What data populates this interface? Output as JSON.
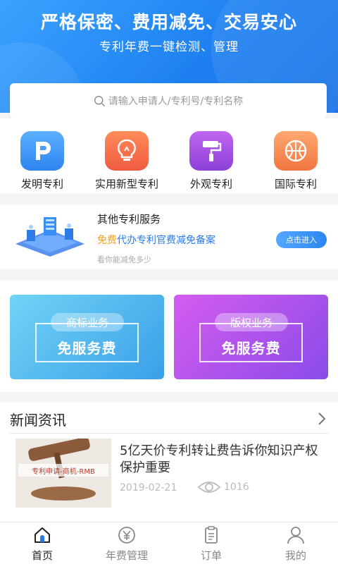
{
  "hero": {
    "title": "严格保密、费用减免、交易安心",
    "subtitle": "专利年费一键检测、管理"
  },
  "search": {
    "placeholder": "请输入申请人/专利号/专利名称",
    "icon": "search-icon"
  },
  "categories": [
    {
      "label": "发明专利",
      "icon": "p-letter-icon",
      "color": "#3b8ff0"
    },
    {
      "label": "实用新型专利",
      "icon": "lightbulb-icon",
      "color": "#f26a4a"
    },
    {
      "label": "外观专利",
      "icon": "paint-roller-icon",
      "color": "#a04de0"
    },
    {
      "label": "国际专利",
      "icon": "basketball-icon",
      "color": "#f2894a"
    }
  ],
  "service": {
    "title": "其他专利服务",
    "free": "免费",
    "desc": "代办专利官费减免备案",
    "note": "看你能减免多少",
    "button": "点击进入"
  },
  "promos": [
    {
      "tag": "商标业务",
      "big": "免服务费",
      "color": "#3aa0e8"
    },
    {
      "tag": "版权业务",
      "big": "免服务费",
      "color": "#8a4be8"
    }
  ],
  "news": {
    "header": "新闻资讯",
    "items": [
      {
        "title": "5亿天价专利转让费告诉你知识产权保护重要",
        "date": "2019-02-21",
        "views": "1016",
        "thumb_text": "专利申请-商机-RMB"
      }
    ]
  },
  "tabs": [
    {
      "label": "首页",
      "icon": "home-icon",
      "active": true
    },
    {
      "label": "年费管理",
      "icon": "yen-coin-icon",
      "active": false
    },
    {
      "label": "订单",
      "icon": "order-list-icon",
      "active": false
    },
    {
      "label": "我的",
      "icon": "user-icon",
      "active": false
    }
  ],
  "colors": {
    "brand": "#1d7ff0",
    "accent_orange": "#f0a020"
  }
}
